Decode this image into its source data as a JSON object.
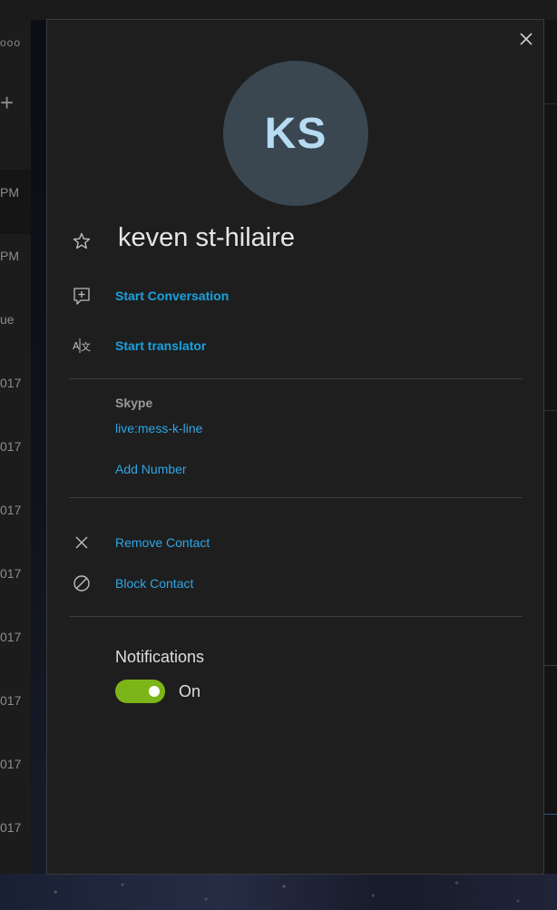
{
  "background": {
    "more_glyph": "ooo",
    "plus_glyph": "+",
    "dates": [
      "PM",
      "PM",
      "ue",
      "017",
      "017",
      "017",
      "017",
      "017",
      "017",
      "017",
      "017"
    ]
  },
  "contact": {
    "initials": "KS",
    "name": "keven st-hilaire",
    "favorite_icon": "star-outline-icon"
  },
  "actions": {
    "start_conversation": "Start Conversation",
    "start_translator": "Start translator"
  },
  "skype": {
    "label": "Skype",
    "id": "live:mess-k-line",
    "add_number": "Add Number"
  },
  "manage": {
    "remove_contact": "Remove Contact",
    "block_contact": "Block Contact"
  },
  "notifications": {
    "label": "Notifications",
    "state": "On",
    "enabled": true
  },
  "colors": {
    "accent": "#18a2e0",
    "toggle_on": "#7cb518",
    "avatar_bg": "#3a4751",
    "avatar_text": "#b6dcf2",
    "panel_bg": "#1e1e1e"
  }
}
